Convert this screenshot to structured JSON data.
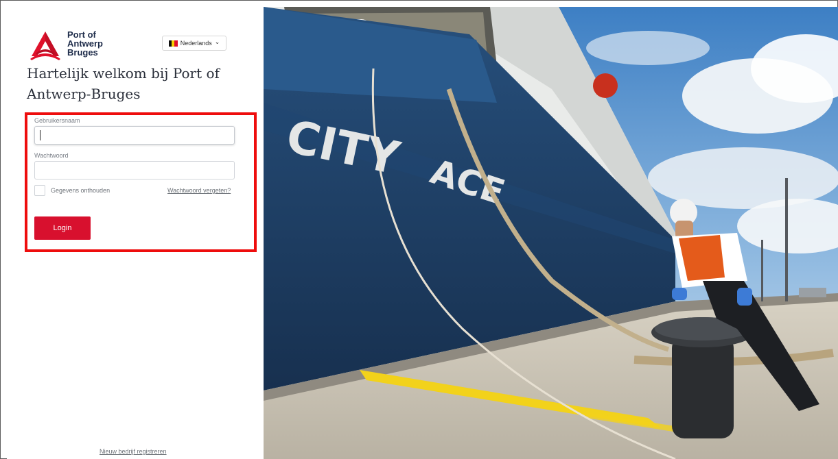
{
  "logo": {
    "line1": "Port of",
    "line2": "Antwerp",
    "line3": "Bruges"
  },
  "language": {
    "selected": "Nederlands",
    "chevron": "⌄"
  },
  "welcome_title": "Hartelijk welkom bij Port of Antwerp-Bruges",
  "form": {
    "username_label": "Gebruikersnaam",
    "username_value": "",
    "password_label": "Wachtwoord",
    "password_value": "",
    "remember_label": "Gegevens onthouden",
    "remember_checked": false,
    "forgot_link": "Wachtwoord vergeten?",
    "login_button": "Login"
  },
  "register_link": "Nieuw bedrijf registreren",
  "photo": {
    "ship_text_1": "CITY",
    "ship_text_2": "ACE"
  },
  "colors": {
    "brand_red": "#d8102e",
    "highlight_red": "#ee0d0d",
    "ship_blue": "#1d3e66"
  },
  "icons": {
    "logo": "port-triangle-logo-icon",
    "flag": "belgium-flag-icon",
    "dropdown": "chevron-down-icon"
  }
}
